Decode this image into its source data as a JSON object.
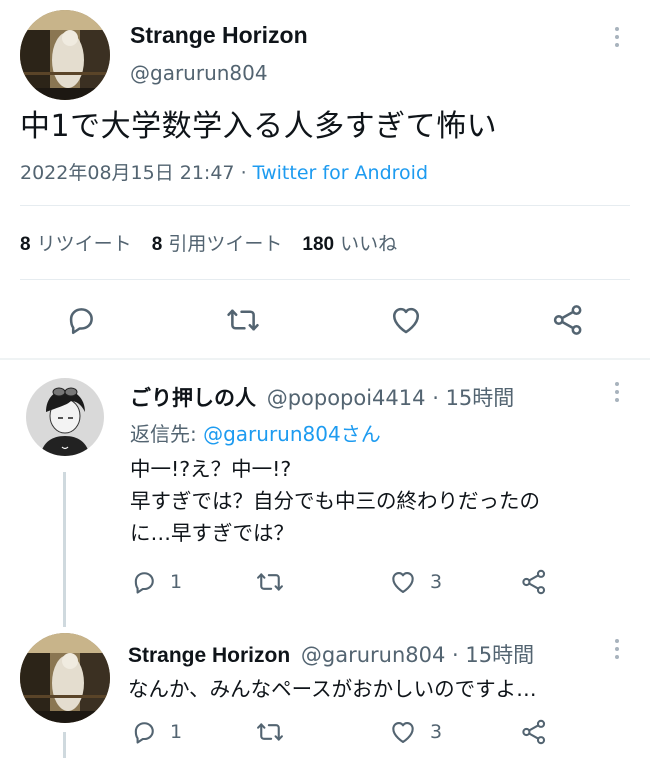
{
  "main_tweet": {
    "author_name": "Strange Horizon",
    "author_handle": "@garurun804",
    "text": "中1で大学数学入る人多すぎて怖い",
    "timestamp": "2022年08月15日 21:47",
    "separator": "·",
    "source": "Twitter for Android",
    "stats": {
      "retweets_count": "8",
      "retweets_label": "リツイート",
      "quotes_count": "8",
      "quotes_label": "引用ツイート",
      "likes_count": "180",
      "likes_label": "いいね"
    }
  },
  "replies": [
    {
      "author_name": "ごり押しの人",
      "author_handle": "@popopoi4414",
      "time": "15時間",
      "reply_to_label": "返信先:",
      "reply_to_handle": "@garurun804さん",
      "line1": "中一!?え？中一!?",
      "line2": "早すぎでは？自分でも中三の終わりだったの",
      "line3": "に…早すぎでは？",
      "reply_count": "1",
      "like_count": "3"
    },
    {
      "author_name": "Strange Horizon",
      "author_handle": "@garurun804",
      "time": "15時間",
      "line1": "なんか、みんなペースがおかしいのですよ…",
      "reply_count": "1",
      "like_count": "3"
    }
  ],
  "colors": {
    "accent": "#1d9bf0",
    "text": "#0f1419",
    "muted": "#536471",
    "divider": "#e6ecf0"
  },
  "icons": [
    "reply-icon",
    "retweet-icon",
    "like-icon",
    "share-icon",
    "more-icon"
  ]
}
